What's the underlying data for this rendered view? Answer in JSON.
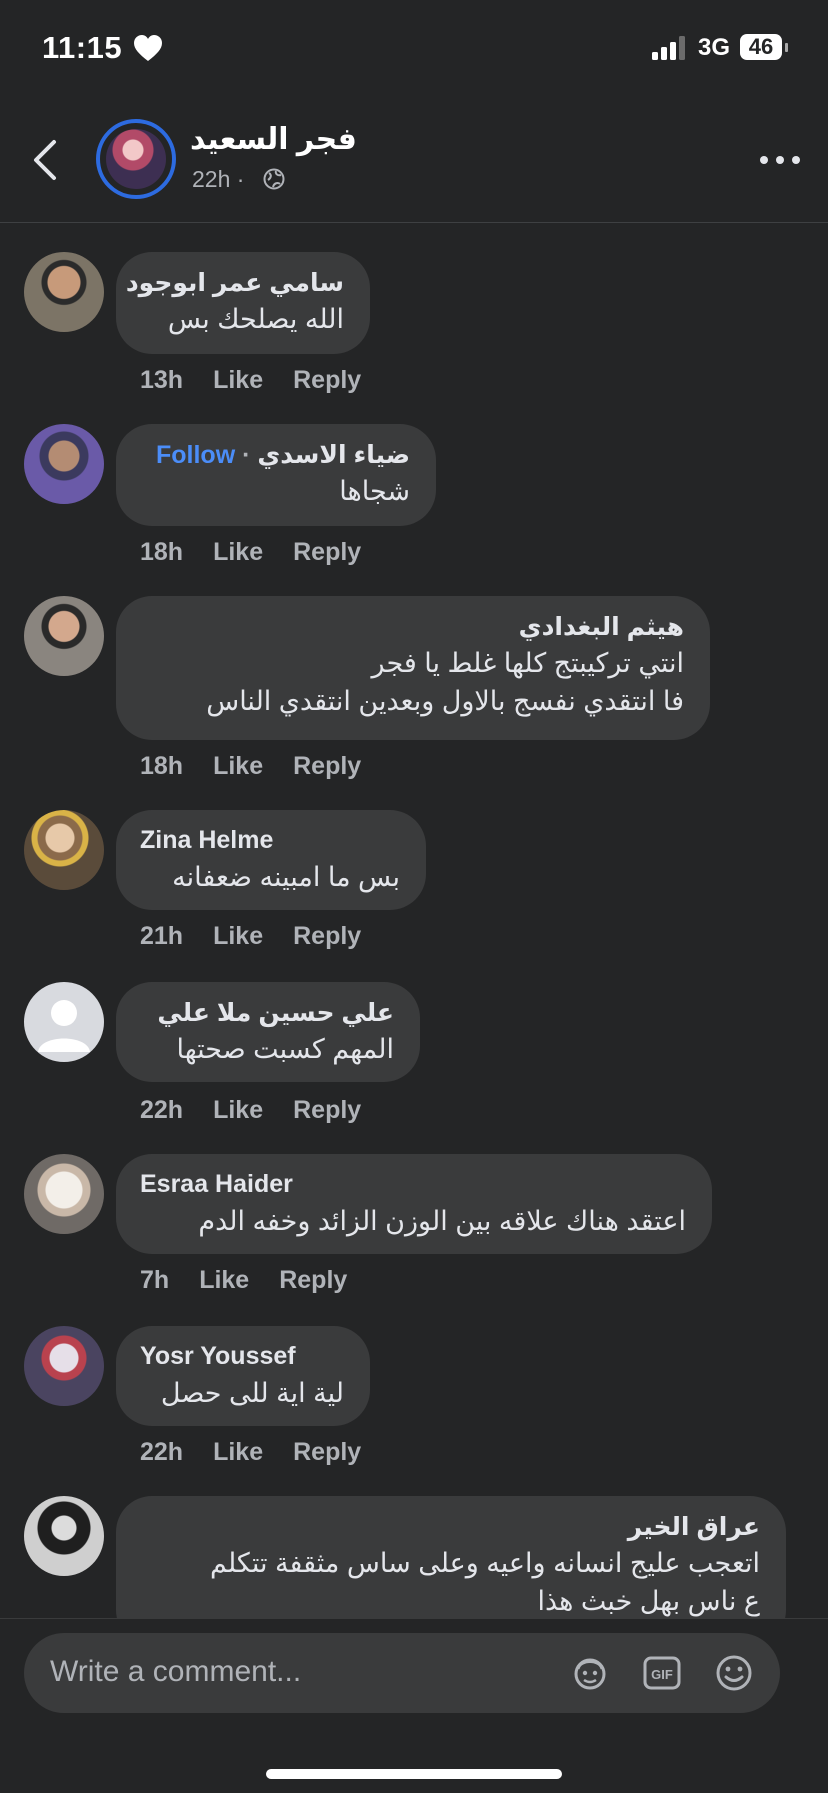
{
  "status": {
    "time": "11:15",
    "network": "3G",
    "battery": "46"
  },
  "header": {
    "name": "فجر السعيد",
    "meta": "22h ·"
  },
  "comments": [
    {
      "name": "سامي عمر ابوجود",
      "lines": [
        "الله يصلحك بس"
      ],
      "time": "13h",
      "like": "Like",
      "reply": "Reply"
    },
    {
      "name": "ضياء الاسدي",
      "follow": "Follow",
      "lines": [
        "شجاها"
      ],
      "time": "18h",
      "like": "Like",
      "reply": "Reply"
    },
    {
      "name": "هيثم البغدادي",
      "lines": [
        "انتي تركيبتج كلها غلط يا فجر",
        "فا انتقدي نفسج بالاول وبعدين انتقدي الناس"
      ],
      "time": "18h",
      "like": "Like",
      "reply": "Reply"
    },
    {
      "name": "Zina Helme",
      "lines": [
        "بس ما امبينه ضعفانه"
      ],
      "time": "21h",
      "like": "Like",
      "reply": "Reply"
    },
    {
      "name": "علي حسين ملا علي",
      "lines": [
        "المهم كسبت صحتها"
      ],
      "time": "22h",
      "like": "Like",
      "reply": "Reply"
    },
    {
      "name": "Esraa Haider",
      "lines": [
        "اعتقد هناك علاقه بين الوزن الزائد وخفه الدم"
      ],
      "time": "7h",
      "like": "Like",
      "reply": "Reply"
    },
    {
      "name": "Yosr Youssef",
      "lines": [
        "لية اية للى حصل"
      ],
      "time": "22h",
      "like": "Like",
      "reply": "Reply"
    },
    {
      "name": "عراق الخير",
      "lines": [
        "اتعجب عليج انسانه واعيه وعلى ساس مثقفة تتكلم",
        "ع ناس بهل خبث هذا"
      ]
    }
  ],
  "composer": {
    "placeholder": "Write a comment..."
  },
  "icons": [
    "heart-icon",
    "signal-icon",
    "back-icon",
    "globe-icon",
    "more-icon",
    "avatar-sticker-icon",
    "gif-icon",
    "emoji-icon"
  ]
}
